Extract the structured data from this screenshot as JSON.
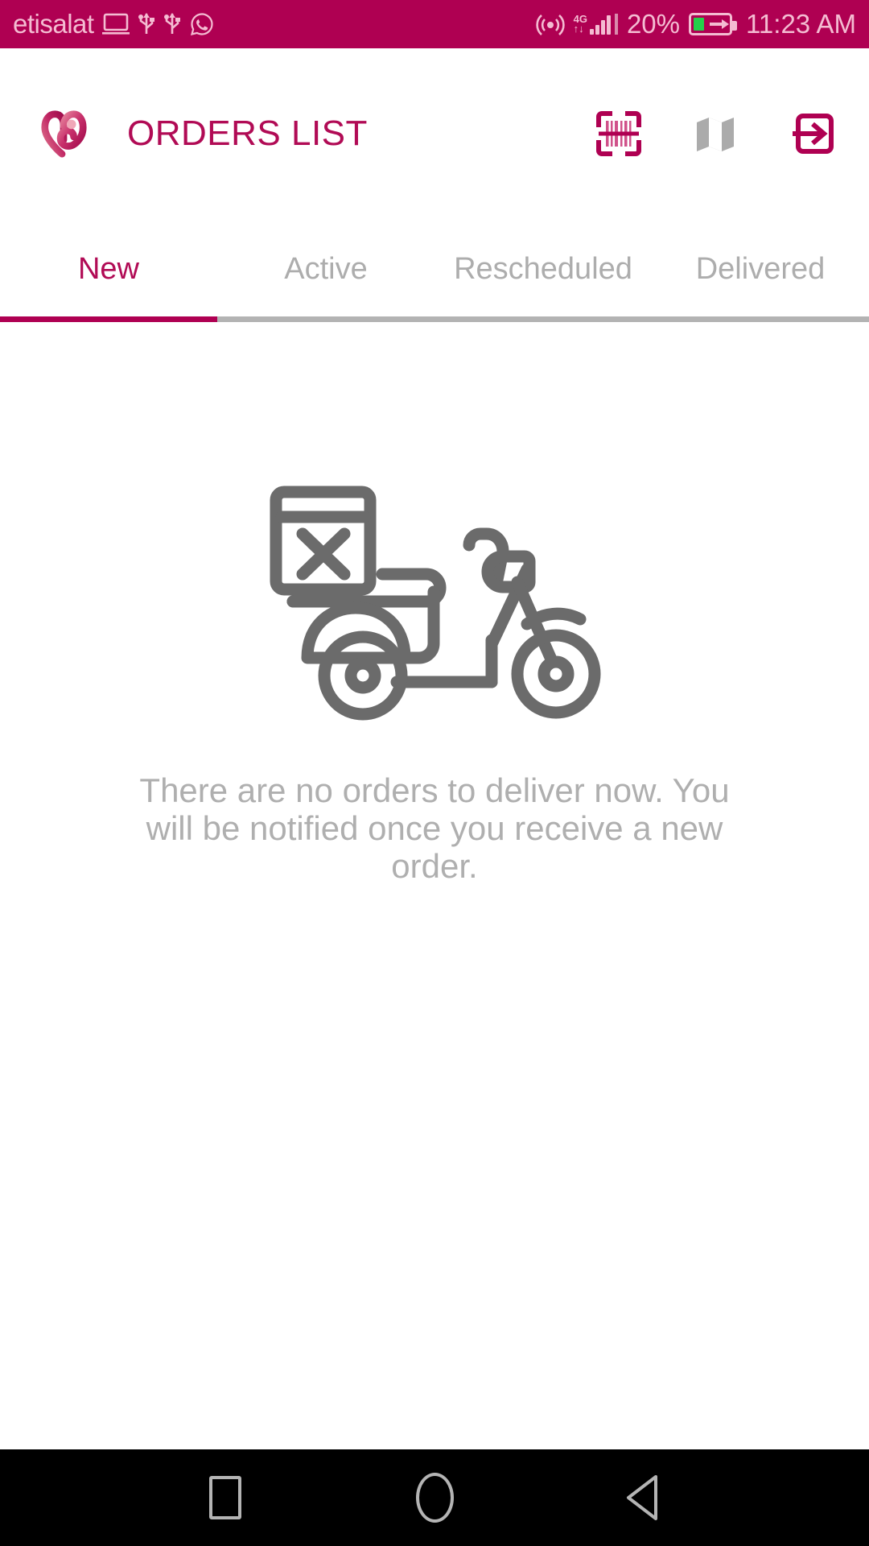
{
  "status_bar": {
    "carrier": "etisalat",
    "icons": [
      "laptop-icon",
      "usb-icon",
      "usb-icon",
      "whatsapp-icon",
      "hotspot-icon"
    ],
    "network_type_top": "4G",
    "network_type_bottom": "↑↓",
    "battery_percent": "20%",
    "battery_state": "charging",
    "time": "11:23 AM",
    "background_color": "#AF0052",
    "foreground_color": "#F4BCD2",
    "battery_fill_color": "#24D04A"
  },
  "app_bar": {
    "logo": "brand-swirl-logo",
    "title": "ORDERS LIST",
    "title_color": "#B10B55",
    "actions": [
      {
        "name": "barcode-scanner",
        "label": "Scan Barcode",
        "color": "#AF0052"
      },
      {
        "name": "map",
        "label": "Map",
        "color": "#ABABAB"
      },
      {
        "name": "logout",
        "label": "Logout",
        "color": "#AF0052"
      }
    ]
  },
  "tabs": {
    "items": [
      {
        "label": "New",
        "active": true
      },
      {
        "label": "Active",
        "active": false
      },
      {
        "label": "Rescheduled",
        "active": false
      },
      {
        "label": "Delivered",
        "active": false
      }
    ],
    "active_color": "#B10B55",
    "inactive_color": "#ADADAD",
    "indicator_color": "#AF0052",
    "divider_color": "#B3B3B3"
  },
  "empty_state": {
    "illustration": "scooter-no-delivery-icon",
    "illustration_color": "#6B6B6B",
    "message": "There are no orders to deliver now. You will be notified once you receive a new order.",
    "message_color": "#AFAFAF"
  },
  "nav_bar": {
    "buttons": [
      {
        "name": "recents",
        "label": "Recents"
      },
      {
        "name": "home",
        "label": "Home"
      },
      {
        "name": "back",
        "label": "Back"
      }
    ],
    "background_color": "#000000",
    "icon_color": "#B4B4B4"
  }
}
